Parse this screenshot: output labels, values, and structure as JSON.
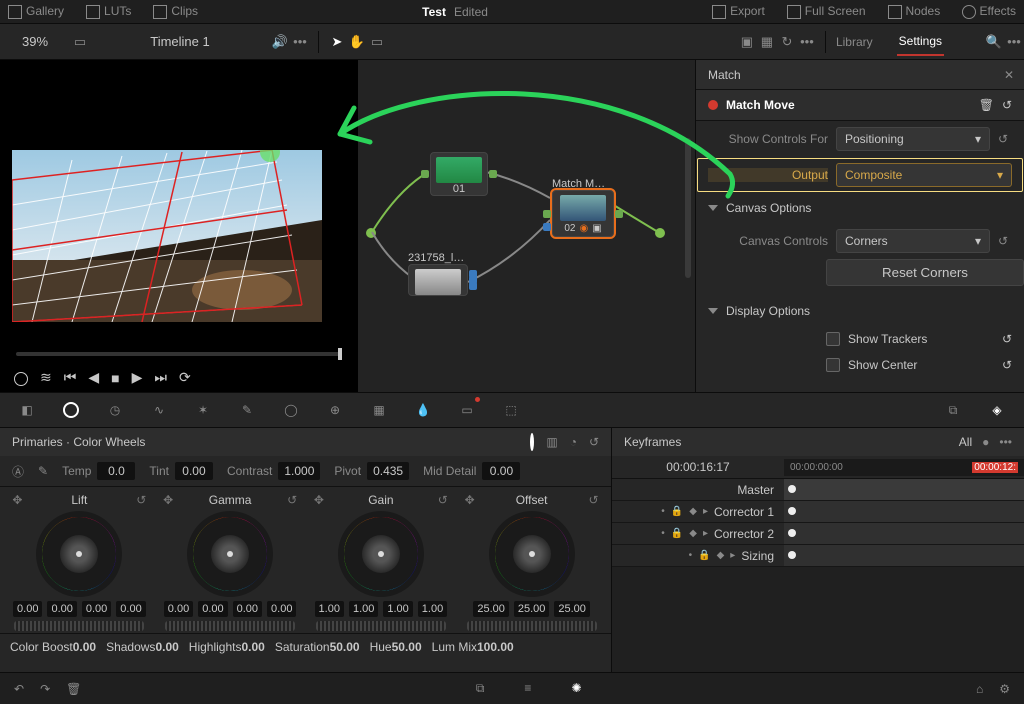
{
  "topbar": {
    "gallery": "Gallery",
    "luts": "LUTs",
    "clips": "Clips",
    "title": "Test",
    "status": "Edited",
    "export": "Export",
    "fullscreen": "Full Screen",
    "nodes": "Nodes",
    "effects": "Effects"
  },
  "bar2": {
    "zoom": "39%",
    "timeline": "Timeline 1",
    "tabs": {
      "library": "Library",
      "settings": "Settings"
    }
  },
  "inspector": {
    "search_value": "Match",
    "effect_name": "Match Move",
    "show_controls_label": "Show Controls For",
    "show_controls_value": "Positioning",
    "output_label": "Output",
    "output_value": "Composite",
    "canvas_options": "Canvas Options",
    "canvas_controls_label": "Canvas Controls",
    "canvas_controls_value": "Corners",
    "reset_corners": "Reset Corners",
    "display_options": "Display Options",
    "show_trackers": "Show Trackers",
    "show_center": "Show Center"
  },
  "nodegraph": {
    "node1": "01",
    "node1_label": "",
    "node2": "02",
    "node2_label": "Match M…",
    "clip_label": "231758_l…"
  },
  "primaries": {
    "title": "Primaries · Color Wheels",
    "adjust": {
      "temp_l": "Temp",
      "temp_v": "0.0",
      "tint_l": "Tint",
      "tint_v": "0.00",
      "contrast_l": "Contrast",
      "contrast_v": "1.000",
      "pivot_l": "Pivot",
      "pivot_v": "0.435",
      "md_l": "Mid Detail",
      "md_v": "0.00"
    },
    "wheels": [
      {
        "name": "Lift",
        "vals": [
          "0.00",
          "0.00",
          "0.00",
          "0.00"
        ]
      },
      {
        "name": "Gamma",
        "vals": [
          "0.00",
          "0.00",
          "0.00",
          "0.00"
        ]
      },
      {
        "name": "Gain",
        "vals": [
          "1.00",
          "1.00",
          "1.00",
          "1.00"
        ]
      },
      {
        "name": "Offset",
        "vals": [
          "25.00",
          "25.00",
          "25.00"
        ]
      }
    ],
    "bottom": {
      "cb_l": "Color Boost",
      "cb_v": "0.00",
      "sh_l": "Shadows",
      "sh_v": "0.00",
      "hl_l": "Highlights",
      "hl_v": "0.00",
      "sat_l": "Saturation",
      "sat_v": "50.00",
      "hue_l": "Hue",
      "hue_v": "50.00",
      "lm_l": "Lum Mix",
      "lm_v": "100.00"
    }
  },
  "keyframes": {
    "title": "Keyframes",
    "all": "All",
    "tc": "00:00:16:17",
    "tc_start": "00:00:00:00",
    "tc_end": "00:00:12:",
    "master": "Master",
    "rows": [
      "Corrector 1",
      "Corrector 2",
      "Sizing"
    ]
  }
}
